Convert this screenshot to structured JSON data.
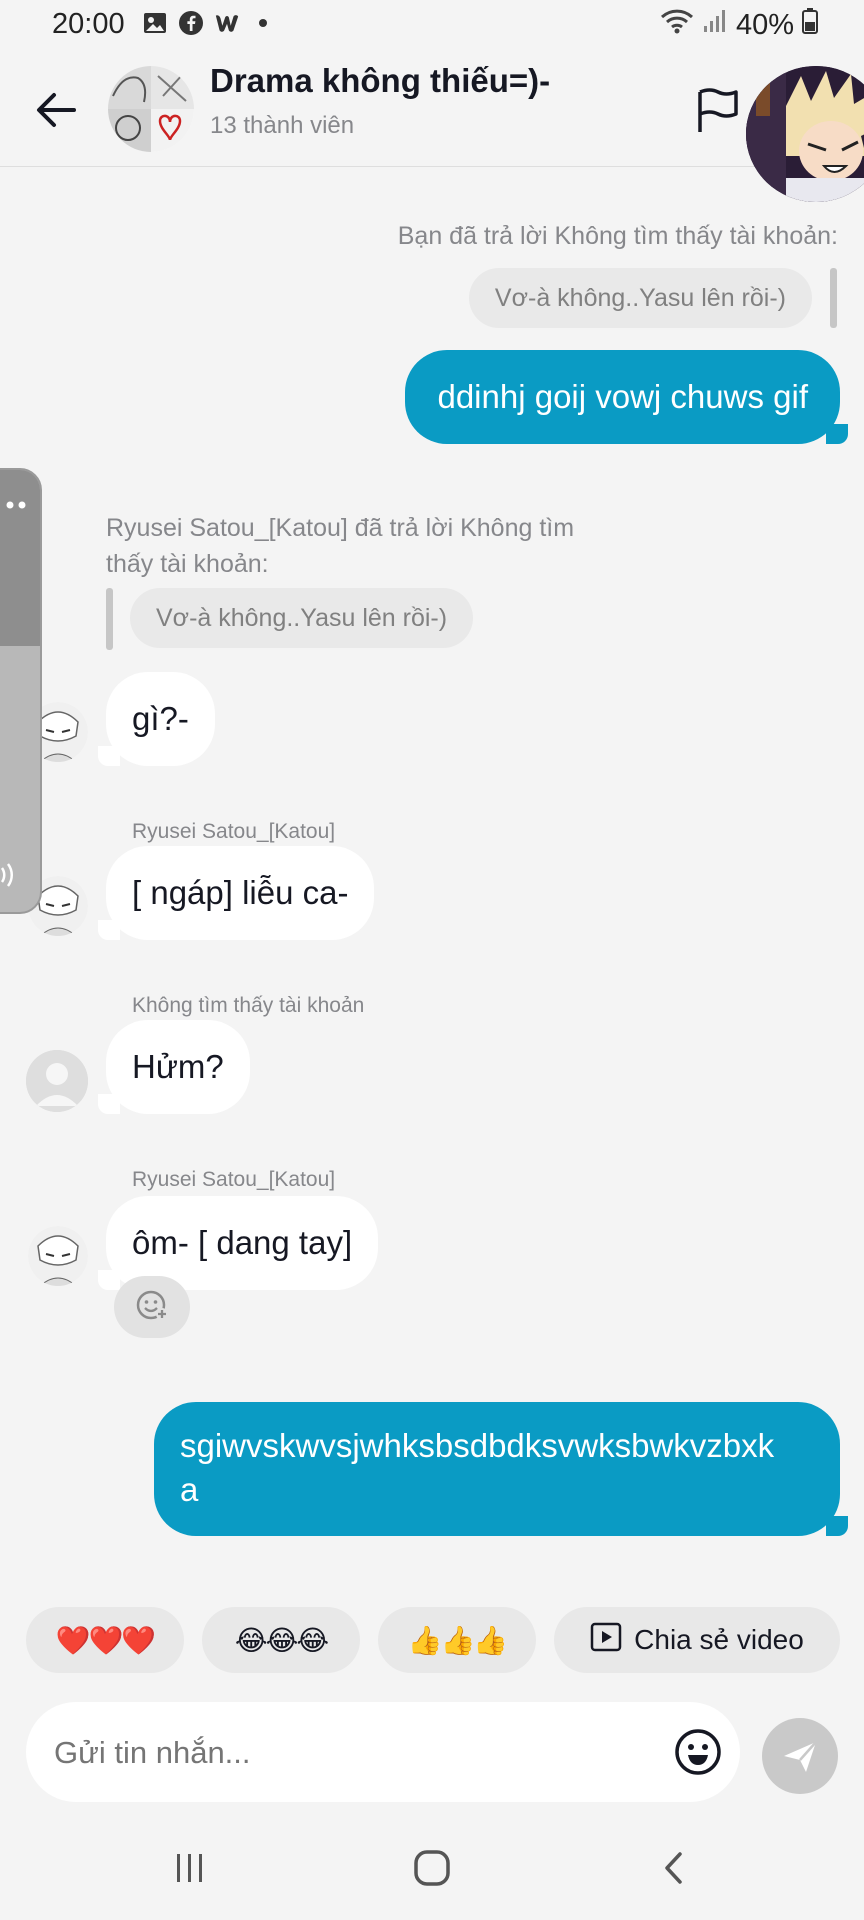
{
  "status": {
    "time": "20:00",
    "battery": "40%",
    "left_icons": [
      "gallery-icon",
      "facebook-icon",
      "wattpad-icon",
      "dot-icon"
    ],
    "right_icons": [
      "wifi-icon",
      "signal-icon",
      "battery-icon"
    ]
  },
  "header": {
    "title": "Drama không thiếu=)-",
    "subtitle": "13 thành viên"
  },
  "messages": {
    "m1_reply_note": "Bạn đã trả lời Không tìm thấy tài khoản:",
    "m1_quote": "Vơ-à không..Yasu lên rồi-)",
    "m1_text": "ddinhj goij vowj chuws gif",
    "m2_reply_note_line1": "Ryusei Satou_[Katou] đã trả lời Không tìm",
    "m2_reply_note_line2": "thấy tài khoản:",
    "m2_quote": "Vơ-à không..Yasu lên rồi-)",
    "m2_text": "gì?-",
    "m3_sender": "Ryusei Satou_[Katou]",
    "m3_text": "[ ngáp] liễu ca-",
    "m4_sender": "Không tìm thấy tài khoản",
    "m4_text": "Hửm?",
    "m5_sender": "Ryusei Satou_[Katou]",
    "m5_text": "ôm- [ dang tay]",
    "m6_text_line1": "sgiwvskwvsjwhksbsdbdksvwksbwkvzbxk",
    "m6_text_line2": "a"
  },
  "quick_replies": {
    "hearts": "❤️❤️❤️",
    "laughs": "😂😂😂",
    "thumbs": "👍👍👍",
    "share_video": "Chia sẻ video"
  },
  "composer": {
    "placeholder": "Gửi tin nhắn..."
  },
  "colors": {
    "outgoing_bubble": "#0a9bc4",
    "incoming_bubble": "#ffffff",
    "background": "#f4f4f4"
  }
}
